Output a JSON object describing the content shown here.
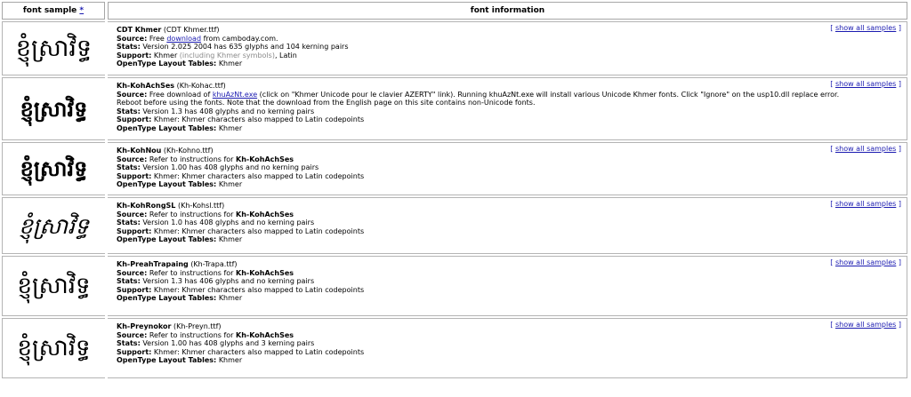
{
  "header": {
    "col1_label": "font sample",
    "col1_sort_marker": "*",
    "col2_label": "font information"
  },
  "labels": {
    "source": "Source:",
    "stats": "Stats:",
    "support": "Support:",
    "opentype": "OpenType Layout Tables:",
    "show_open": "[ ",
    "show_link": "show all samples",
    "show_close": " ]"
  },
  "fonts": [
    {
      "sample": "ខ្ញុំស្រាវិទ្ធ",
      "name": "CDT Khmer",
      "file": "(CDT Khmer.ttf)",
      "source_pre": "Free ",
      "source_link": "download",
      "source_post": " from camboday.com.",
      "stats": "Version 2.025 2004 has 635 glyphs and 104 kerning pairs",
      "support_main": "Khmer",
      "support_note": " (including Khmer symbols)",
      "support_post": ", Latin",
      "opentype": "Khmer"
    },
    {
      "sample": "ខ្ញុំស្រាវិទ្ធ",
      "name": "Kh-KohAchSes",
      "file": "(Kh-Kohac.ttf)",
      "source_pre": "Free download of ",
      "source_link": "khuAzNt.exe",
      "source_post": " (click on \"Khmer Unicode pour le clavier AZERTY\" link). Running khuAzNt.exe will install various Unicode Khmer fonts. Click \"Ignore\" on the usp10.dll replace error. Reboot before using the fonts. Note that the download from the English page on this site contains non-Unicode fonts.",
      "stats": "Version 1.3 has 408 glyphs and no kerning pairs",
      "support_main": "Khmer: Khmer characters also mapped to Latin codepoints",
      "support_note": "",
      "support_post": "",
      "opentype": "Khmer"
    },
    {
      "sample": "ខ្ញុំស្រាវិទ្ធ",
      "name": "Kh-KohNou",
      "file": "(Kh-Kohno.ttf)",
      "source_pre": "Refer to instructions for ",
      "source_bold": "Kh-KohAchSes",
      "stats": "Version 1.00 has 408 glyphs and no kerning pairs",
      "support_main": "Khmer: Khmer characters also mapped to Latin codepoints",
      "support_note": "",
      "support_post": "",
      "opentype": "Khmer"
    },
    {
      "sample": "ខ្ញុំស្រាវិទ្ធ",
      "name": "Kh-KohRongSL",
      "file": "(Kh-Kohsl.ttf)",
      "source_pre": "Refer to instructions for ",
      "source_bold": "Kh-KohAchSes",
      "stats": "Version 1.0 has 408 glyphs and no kerning pairs",
      "support_main": "Khmer: Khmer characters also mapped to Latin codepoints",
      "support_note": "",
      "support_post": "",
      "opentype": "Khmer"
    },
    {
      "sample": "ខ្ញុំស្រាវិទ្ធ",
      "name": "Kh-PreahTrapaing",
      "file": "(Kh-Trapa.ttf)",
      "source_pre": "Refer to instructions for ",
      "source_bold": "Kh-KohAchSes",
      "stats": "Version 1.3 has 406 glyphs and no kerning pairs",
      "support_main": "Khmer: Khmer characters also mapped to Latin codepoints",
      "support_note": "",
      "support_post": "",
      "opentype": "Khmer"
    },
    {
      "sample": "ខ្ញុំស្រាវិទ្ធ",
      "name": "Kh-Preynokor",
      "file": "(Kh-Preyn.ttf)",
      "source_pre": "Refer to instructions for ",
      "source_bold": "Kh-KohAchSes",
      "stats": "Version 1.00 has 408 glyphs and 3 kerning pairs",
      "support_main": "Khmer: Khmer characters also mapped to Latin codepoints",
      "support_note": "",
      "support_post": "",
      "opentype": "Khmer"
    }
  ]
}
